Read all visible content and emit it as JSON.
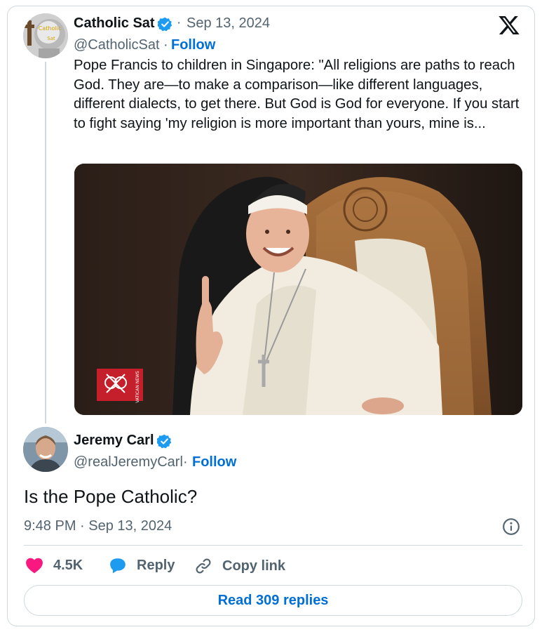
{
  "quoted_tweet": {
    "author_name": "Catholic Sat",
    "avatar_text_line1": "Catholic",
    "avatar_text_line2": "Sat",
    "verified": true,
    "date": "Sep 13, 2024",
    "handle": "@CatholicSat",
    "follow_label": "Follow",
    "text": "Pope Francis to children in Singapore: \"All religions are paths to reach God. They are—to make a comparison—like different languages, different dialects, to get there. But God is God for everyone. If you start to fight saying 'my religion is more important than yours, mine is...",
    "media_watermark": "VATICAN NEWS",
    "icon": "x-logo-icon"
  },
  "main_tweet": {
    "author_name": "Jeremy Carl",
    "verified": true,
    "handle": "@realJeremyCarl",
    "follow_label": "Follow",
    "text": "Is the Pope Catholic?",
    "timestamp": "9:48 PM · Sep 13, 2024"
  },
  "actions": {
    "like_count": "4.5K",
    "reply_label": "Reply",
    "copy_link_label": "Copy link",
    "read_replies_label": "Read 309 replies"
  },
  "separator": "·",
  "colors": {
    "link": "#006fd6",
    "secondary_text": "#536471",
    "verified": "#1d9bf0",
    "like": "#f91880",
    "border": "#cfd9de"
  }
}
